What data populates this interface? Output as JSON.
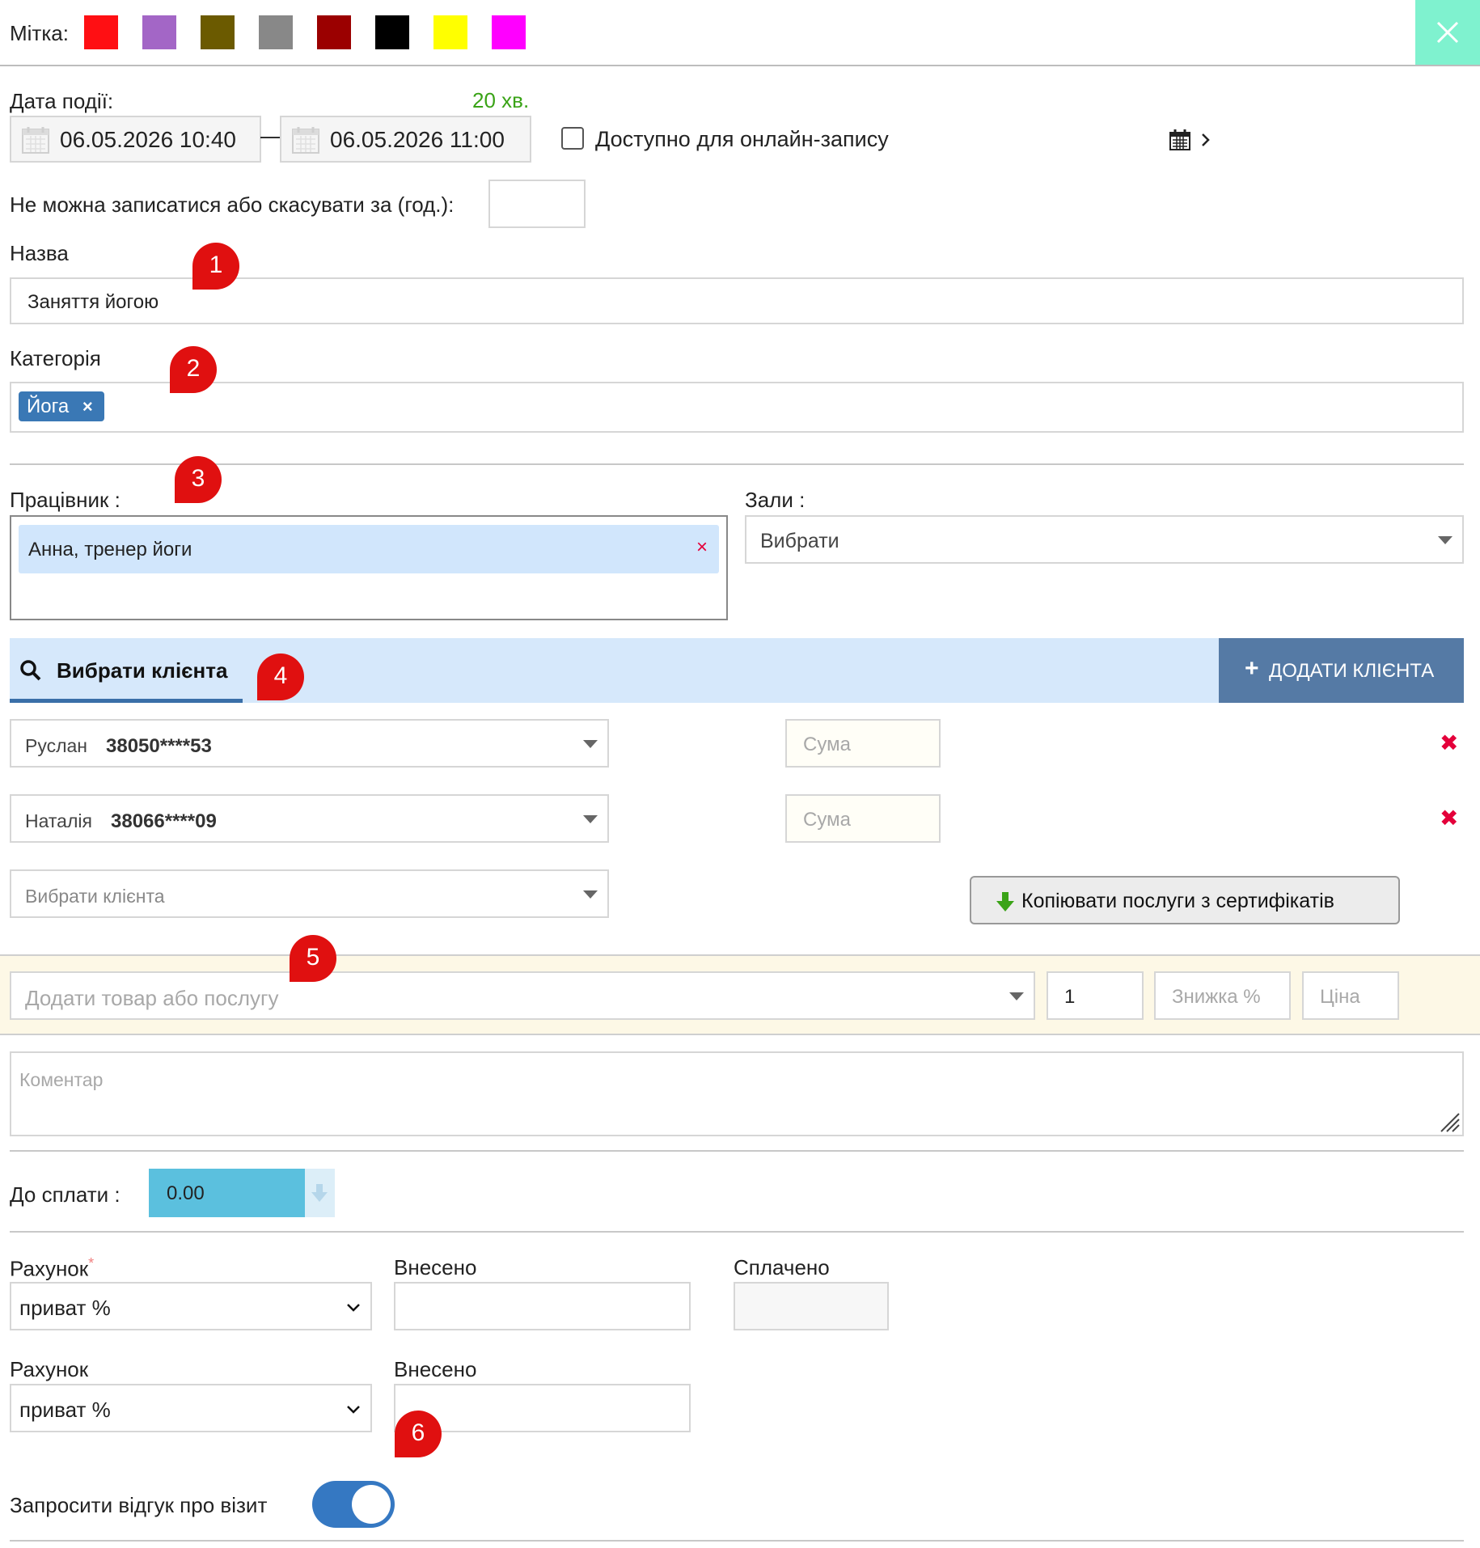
{
  "label_bar": {
    "title": "Мітка:",
    "colors": [
      "#ff0f13",
      "#a366c6",
      "#6b5a00",
      "#888888",
      "#9b0000",
      "#000000",
      "#ffff00",
      "#ff00ff"
    ],
    "close_bg": "#7ff2cf"
  },
  "event_date": {
    "label": "Дата події:",
    "duration": "20 хв.",
    "start": "06.05.2026 10:40",
    "dash": "—",
    "end": "06.05.2026 11:00",
    "online_label": "Доступно для онлайн-запису"
  },
  "cancel_limit": {
    "label": "Не можна записатися або скасувати за (год.):",
    "value": ""
  },
  "name": {
    "label": "Назва",
    "value": "Заняття йогою"
  },
  "category": {
    "label": "Категорія",
    "tag": "Йога"
  },
  "employee": {
    "label": "Працівник :",
    "value": "Анна, тренер йоги"
  },
  "halls": {
    "label": "Зали :",
    "value": "Вибрати"
  },
  "client_tab": {
    "label": "Вибрати клієнта",
    "add_button": "ДОДАТИ КЛІЄНТА"
  },
  "clients": [
    {
      "name": "Руслан",
      "phone": "38050****53",
      "sum_placeholder": "Сума"
    },
    {
      "name": "Наталія",
      "phone": "38066****09",
      "sum_placeholder": "Сума"
    }
  ],
  "client_select_placeholder": "Вибрати клієнта",
  "copy_button": "Копіювати послуги з сертифікатів",
  "product": {
    "placeholder": "Додати товар або послугу",
    "qty": "1",
    "discount_placeholder": "Знижка %",
    "price_placeholder": "Ціна"
  },
  "comment_placeholder": "Коментар",
  "to_pay": {
    "label": "До сплати :",
    "value": "0.00"
  },
  "payments": [
    {
      "account_label": "Рахунок",
      "required": "*",
      "account_value": "приват %",
      "deposited_label": "Внесено",
      "deposited_value": "",
      "paid_label": "Сплачено",
      "paid_value": ""
    },
    {
      "account_label": "Рахунок",
      "account_value": "приват %",
      "deposited_label": "Внесено",
      "deposited_value": ""
    }
  ],
  "feedback": {
    "label": "Запросити відгук про візит",
    "enabled": true
  },
  "markers": [
    "1",
    "2",
    "3",
    "4",
    "5",
    "6"
  ],
  "colors": {
    "tag_blue": "#3a78b5",
    "add_btn": "#557aa5",
    "client_bar": "#d6e8fb",
    "product_bar": "#fdf8e6",
    "pay_box": "#5bc0de",
    "toggle": "#3578c2"
  }
}
